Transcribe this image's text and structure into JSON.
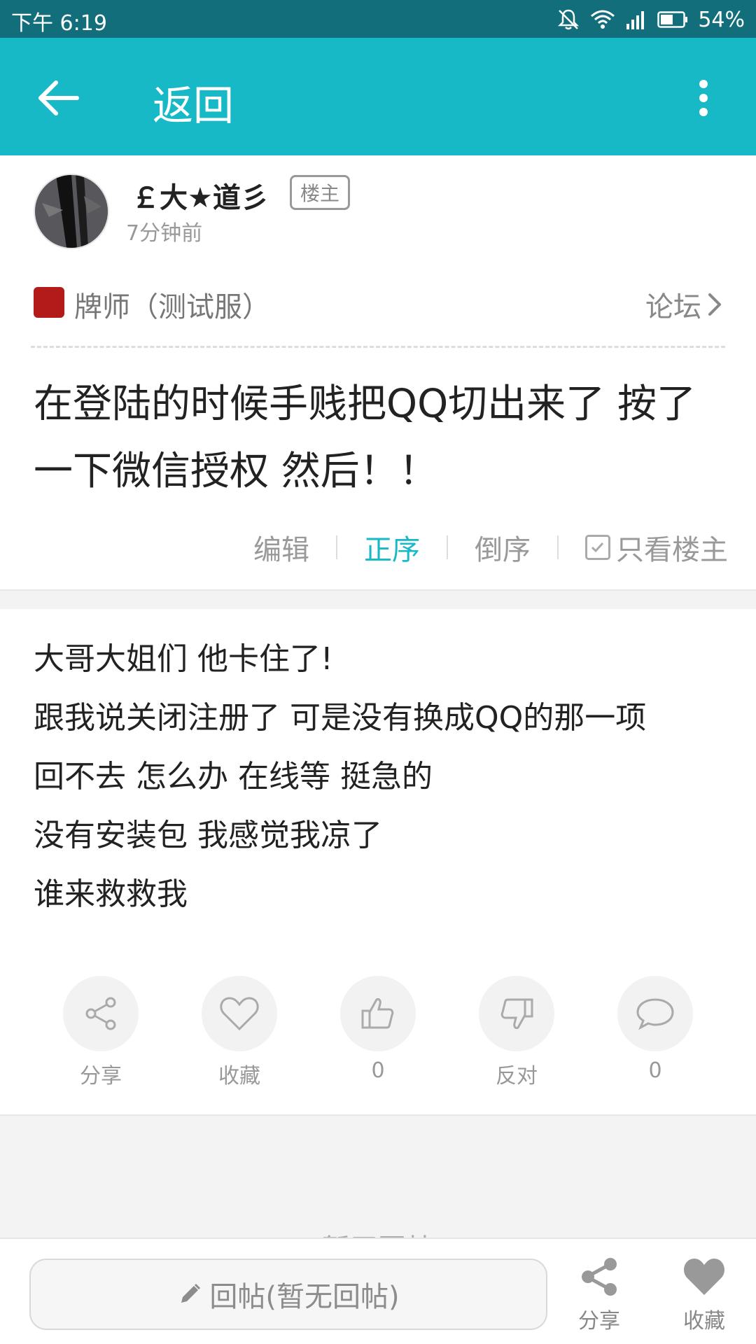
{
  "status_bar": {
    "time": "下午 6:19",
    "battery": "54%",
    "icons": [
      "mute-bell-icon",
      "wifi-icon",
      "signal-icon",
      "battery-icon"
    ]
  },
  "app_bar": {
    "title": "返回"
  },
  "author": {
    "name": "￡大★道彡",
    "badge": "楼主",
    "time": "7分钟前"
  },
  "forum": {
    "name": "牌师（测试服）",
    "link": "论坛"
  },
  "post": {
    "title": "在登陆的时候手贱把QQ切出来了 按了一下微信授权 然后！！",
    "content": [
      "大哥大姐们 他卡住了!",
      "跟我说关闭注册了 可是没有换成QQ的那一项",
      "回不去 怎么办 在线等 挺急的",
      "没有安装包 我感觉我凉了",
      "谁来救救我"
    ]
  },
  "sort": {
    "edit": "编辑",
    "asc": "正序",
    "desc": "倒序",
    "only_op": "只看楼主"
  },
  "actions": {
    "share": "分享",
    "favorite": "收藏",
    "like_count": "0",
    "oppose": "反对",
    "comment_count": "0"
  },
  "replies": {
    "empty": "暂无回帖"
  },
  "bottom_bar": {
    "reply_placeholder": "回帖(暂无回帖)",
    "share": "分享",
    "favorite": "收藏"
  },
  "colors": {
    "status_bar": "#116e7a",
    "app_bar": "#17b9c7",
    "accent": "#17b9c7"
  }
}
